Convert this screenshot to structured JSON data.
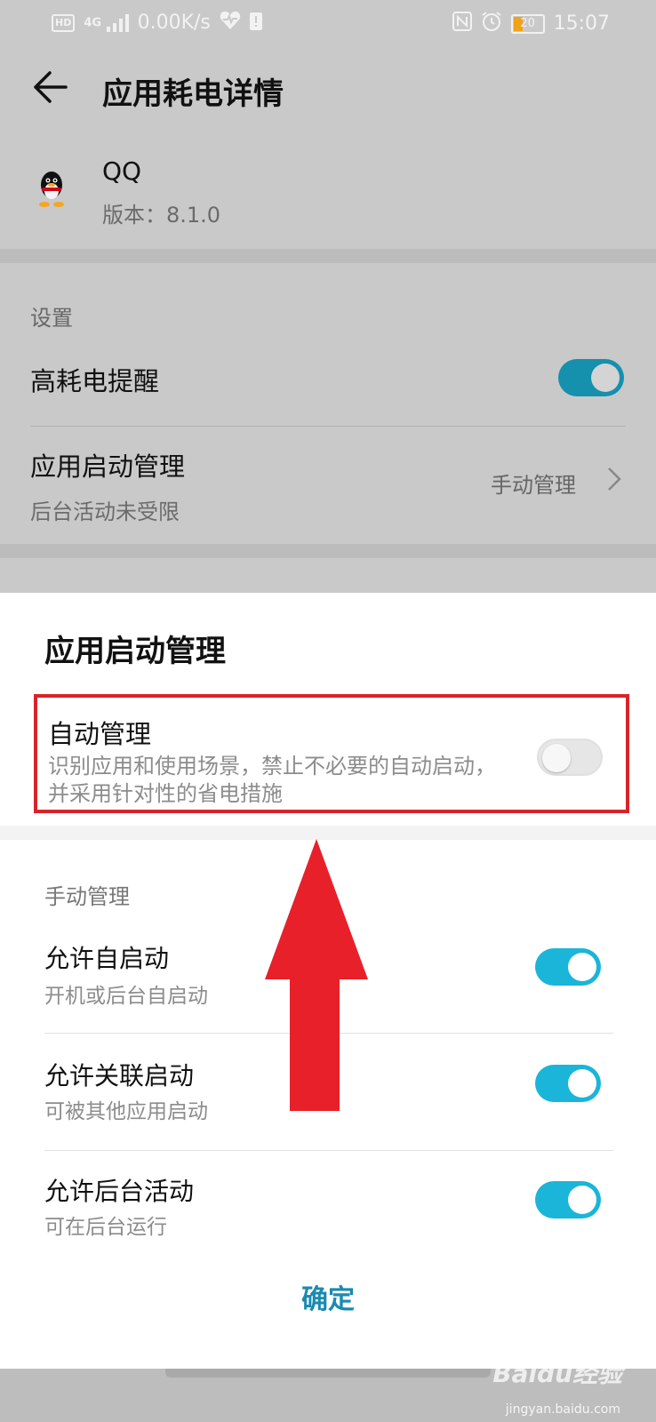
{
  "status_bar": {
    "hd": "HD",
    "network": "4G",
    "speed": "0.00K/s",
    "battery": "20",
    "time": "15:07"
  },
  "app_bar": {
    "title": "应用耗电详情"
  },
  "app_info": {
    "name": "QQ",
    "version_label": "版本：",
    "version": "8.1.0"
  },
  "settings": {
    "section_title": "设置",
    "high_power_alert": {
      "label": "高耗电提醒",
      "enabled": true
    },
    "startup_management": {
      "label": "应用启动管理",
      "sublabel": "后台活动未受限",
      "value": "手动管理"
    }
  },
  "sheet": {
    "title": "应用启动管理",
    "auto_management": {
      "label": "自动管理",
      "description": "识别应用和使用场景，禁止不必要的自动启动，并采用针对性的省电措施",
      "enabled": false
    },
    "manual_section_title": "手动管理",
    "manual_items": [
      {
        "label": "允许自启动",
        "sublabel": "开机或后台自启动",
        "enabled": true
      },
      {
        "label": "允许关联启动",
        "sublabel": "可被其他应用启动",
        "enabled": true
      },
      {
        "label": "允许后台活动",
        "sublabel": "可在后台运行",
        "enabled": true
      }
    ],
    "confirm_label": "确定"
  },
  "watermark": {
    "brand": "Baidu经验",
    "url": "jingyan.baidu.com"
  },
  "colors": {
    "toggle_on": "#1ab5d9",
    "highlight_border": "#d9232a",
    "arrow": "#e8202a",
    "confirm_text": "#1a8ab0"
  }
}
